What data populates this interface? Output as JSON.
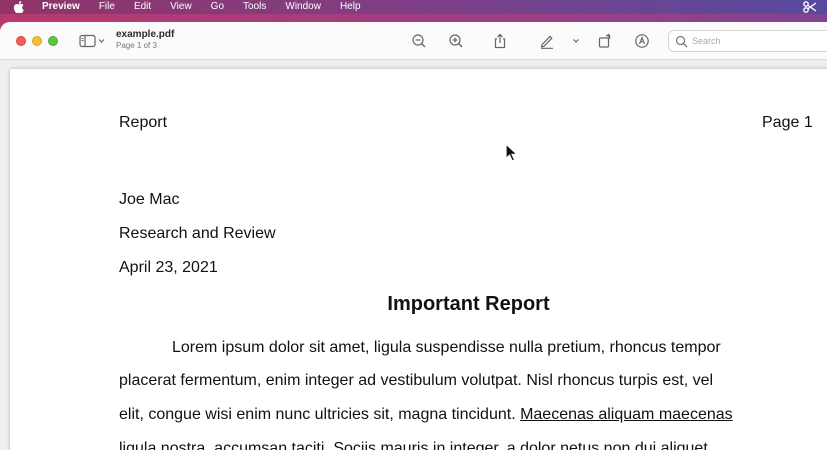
{
  "menubar": {
    "app": "Preview",
    "items": [
      "File",
      "Edit",
      "View",
      "Go",
      "Tools",
      "Window",
      "Help"
    ]
  },
  "window": {
    "doc_title": "example.pdf",
    "doc_subtitle": "Page 1 of 3",
    "search": {
      "placeholder": "Search",
      "value": ""
    }
  },
  "icons": {
    "sidebar": "sidebar-icon",
    "zoom_out": "zoom-out-icon",
    "zoom_in": "zoom-in-icon",
    "share": "share-icon",
    "markup": "pencil-icon",
    "rotate": "rotate-icon",
    "annotate": "markup-circle-icon"
  },
  "document": {
    "header_left": "Report",
    "header_right": "Page 1",
    "author": "Joe Mac",
    "department": "Research and Review",
    "date": "April 23, 2021",
    "title": "Important Report",
    "para_line1": "Lorem ipsum dolor sit amet, ligula suspendisse nulla pretium, rhoncus tempor",
    "para_line2": "placerat fermentum, enim integer ad vestibulum volutpat. Nisl rhoncus turpis est, vel",
    "para_line3_plain": "elit, congue wisi enim nunc ultricies sit, magna tincidunt. ",
    "para_line3_link": "Maecenas aliquam maecenas",
    "para_line4": "ligula nostra, accumsan taciti. Sociis mauris in integer, a dolor netus non dui aliquet,"
  },
  "colors": {
    "close": "#ee5f57",
    "minimize": "#f5bd3d",
    "zoom": "#5fc644"
  }
}
